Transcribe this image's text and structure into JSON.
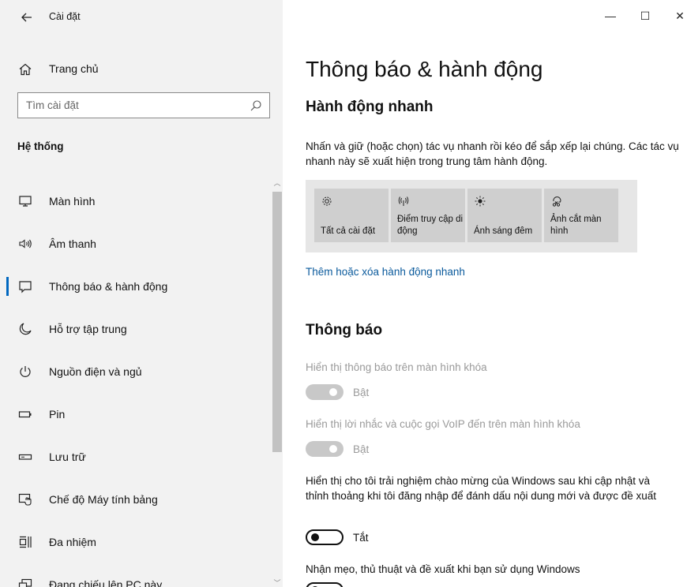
{
  "window": {
    "title": "Cài đặt",
    "controls": {
      "minimize": "—",
      "maximize": "☐",
      "close": "✕"
    }
  },
  "sidebar": {
    "home_label": "Trang chủ",
    "search_placeholder": "Tìm cài đặt",
    "section_title": "Hệ thống",
    "items": [
      {
        "label": "Màn hình",
        "icon": "monitor-icon",
        "active": false
      },
      {
        "label": "Âm thanh",
        "icon": "speaker-icon",
        "active": false
      },
      {
        "label": "Thông báo & hành động",
        "icon": "notification-icon",
        "active": true
      },
      {
        "label": "Hỗ trợ tập trung",
        "icon": "moon-icon",
        "active": false
      },
      {
        "label": "Nguồn điện và ngủ",
        "icon": "power-icon",
        "active": false
      },
      {
        "label": "Pin",
        "icon": "battery-icon",
        "active": false
      },
      {
        "label": "Lưu trữ",
        "icon": "storage-icon",
        "active": false
      },
      {
        "label": "Chế độ Máy tính bảng",
        "icon": "tablet-mode-icon",
        "active": false
      },
      {
        "label": "Đa nhiệm",
        "icon": "multitasking-icon",
        "active": false
      },
      {
        "label": "Đang chiếu lên PC này",
        "icon": "projecting-icon",
        "active": false
      }
    ]
  },
  "main": {
    "title": "Thông báo & hành động",
    "quick_actions": {
      "heading": "Hành động nhanh",
      "description": "Nhấn và giữ (hoặc chọn) tác vụ nhanh rồi kéo để sắp xếp lại chúng. Các tác vụ nhanh này sẽ xuất hiện trong trung tâm hành động.",
      "tiles": [
        {
          "label": "Tất cả cài đặt",
          "icon": "gear-icon"
        },
        {
          "label": "Điểm truy cập di động",
          "icon": "hotspot-icon"
        },
        {
          "label": "Ánh sáng đêm",
          "icon": "brightness-icon"
        },
        {
          "label": "Ảnh cắt màn hình",
          "icon": "screen-snip-icon"
        }
      ],
      "link": "Thêm hoặc xóa hành động nhanh"
    },
    "notifications": {
      "heading": "Thông báo",
      "settings": [
        {
          "label": "Hiển thị thông báo trên màn hình khóa",
          "state": "Bật",
          "disabled": true
        },
        {
          "label": "Hiển thị lời nhắc và cuộc gọi VoIP đến trên màn hình khóa",
          "state": "Bật",
          "disabled": true
        },
        {
          "label": "Hiển thị cho tôi trải nghiệm chào mừng của Windows sau khi cập nhật và thỉnh thoảng khi tôi đăng nhập để đánh dấu nội dung mới và được đề xuất",
          "state": "Tắt",
          "disabled": false
        },
        {
          "label": "Nhận mẹo, thủ thuật và đề xuất khi bạn sử dụng Windows",
          "state": "",
          "disabled": false
        }
      ]
    }
  },
  "colors": {
    "accent": "#0067c0",
    "link": "#0a5a9c",
    "sidebar_bg": "#f2f2f2"
  }
}
